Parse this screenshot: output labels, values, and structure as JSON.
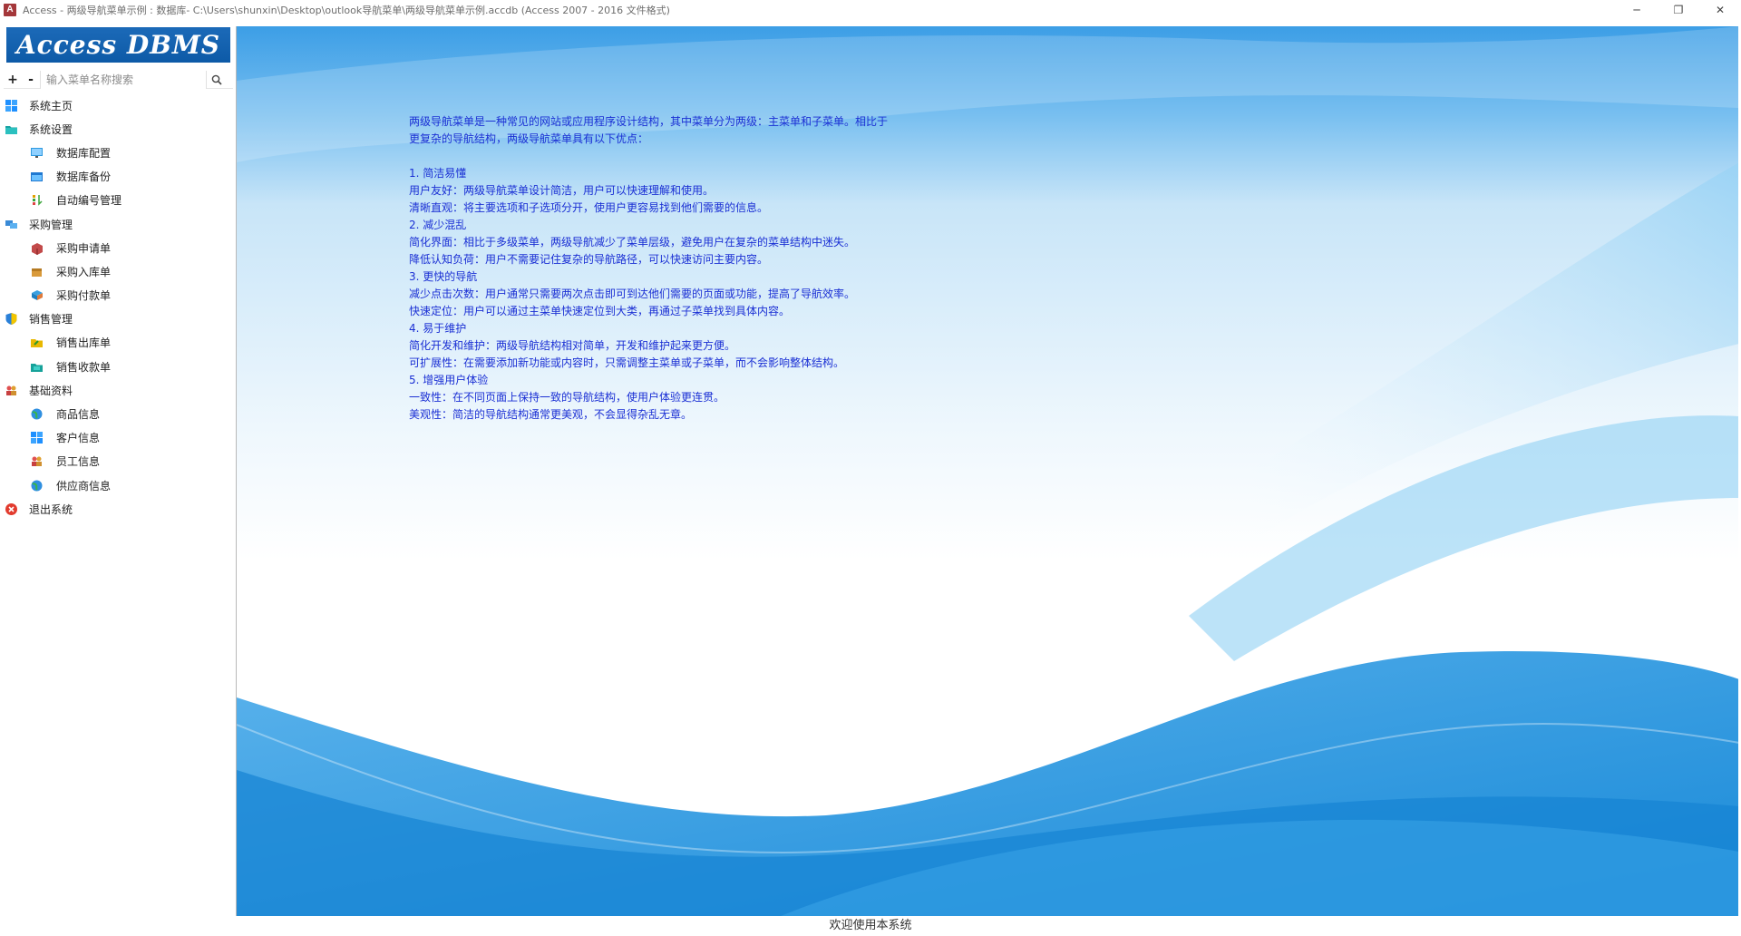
{
  "window": {
    "title": "Access - 两级导航菜单示例 : 数据库- C:\\Users\\shunxin\\Desktop\\outlook导航菜单\\两级导航菜单示例.accdb (Access 2007 - 2016 文件格式)",
    "app_icon": "A",
    "minimize_symbol": "─",
    "restore_symbol": "❐",
    "close_symbol": "✕"
  },
  "sidebar": {
    "logo": "Access DBMS",
    "expand_label": "+",
    "collapse_label": "-",
    "search_placeholder": "输入菜单名称搜索",
    "menu": [
      {
        "label": "系统主页",
        "level": 1,
        "icon": "windows-tiles-icon"
      },
      {
        "label": "系统设置",
        "level": 1,
        "icon": "folder-icon"
      },
      {
        "label": "数据库配置",
        "level": 2,
        "icon": "monitor-icon"
      },
      {
        "label": "数据库备份",
        "level": 2,
        "icon": "window-icon"
      },
      {
        "label": "自动编号管理",
        "level": 2,
        "icon": "sort-icon"
      },
      {
        "label": "采购管理",
        "level": 1,
        "icon": "computers-icon"
      },
      {
        "label": "采购申请单",
        "level": 2,
        "icon": "box-icon"
      },
      {
        "label": "采购入库单",
        "level": 2,
        "icon": "package-icon"
      },
      {
        "label": "采购付款单",
        "level": 2,
        "icon": "payment-icon"
      },
      {
        "label": "销售管理",
        "level": 1,
        "icon": "shield-icon"
      },
      {
        "label": "销售出库单",
        "level": 2,
        "icon": "folder-out-icon"
      },
      {
        "label": "销售收款单",
        "level": 2,
        "icon": "folder-in-icon"
      },
      {
        "label": "基础资料",
        "level": 1,
        "icon": "people-icon"
      },
      {
        "label": "商品信息",
        "level": 2,
        "icon": "globe-icon"
      },
      {
        "label": "客户信息",
        "level": 2,
        "icon": "windows-tiles-icon"
      },
      {
        "label": "员工信息",
        "level": 2,
        "icon": "people-icon"
      },
      {
        "label": "供应商信息",
        "level": 2,
        "icon": "globe-icon"
      },
      {
        "label": "退出系统",
        "level": 1,
        "icon": "exit-icon"
      }
    ]
  },
  "main": {
    "lines": [
      "两级导航菜单是一种常见的网站或应用程序设计结构，其中菜单分为两级：主菜单和子菜单。相比于",
      "更复杂的导航结构，两级导航菜单具有以下优点：",
      "",
      "1. 简洁易懂",
      "用户友好：两级导航菜单设计简洁，用户可以快速理解和使用。",
      "清晰直观：将主要选项和子选项分开，使用户更容易找到他们需要的信息。",
      "2. 减少混乱",
      "简化界面：相比于多级菜单，两级导航减少了菜单层级，避免用户在复杂的菜单结构中迷失。",
      "降低认知负荷：用户不需要记住复杂的导航路径，可以快速访问主要内容。",
      "3. 更快的导航",
      "减少点击次数：用户通常只需要两次点击即可到达他们需要的页面或功能，提高了导航效率。",
      "快速定位：用户可以通过主菜单快速定位到大类，再通过子菜单找到具体内容。",
      "4. 易于维护",
      "简化开发和维护：两级导航结构相对简单，开发和维护起来更方便。",
      "可扩展性：在需要添加新功能或内容时，只需调整主菜单或子菜单，而不会影响整体结构。",
      "5. 增强用户体验",
      "一致性：在不同页面上保持一致的导航结构，使用户体验更连贯。",
      "美观性：简洁的导航结构通常更美观，不会显得杂乱无章。"
    ]
  },
  "statusbar": {
    "text": "欢迎使用本系统"
  },
  "colors": {
    "accent": "#0d5aa7",
    "body_text": "#1a2fd4",
    "wave": "#1e90dc"
  }
}
